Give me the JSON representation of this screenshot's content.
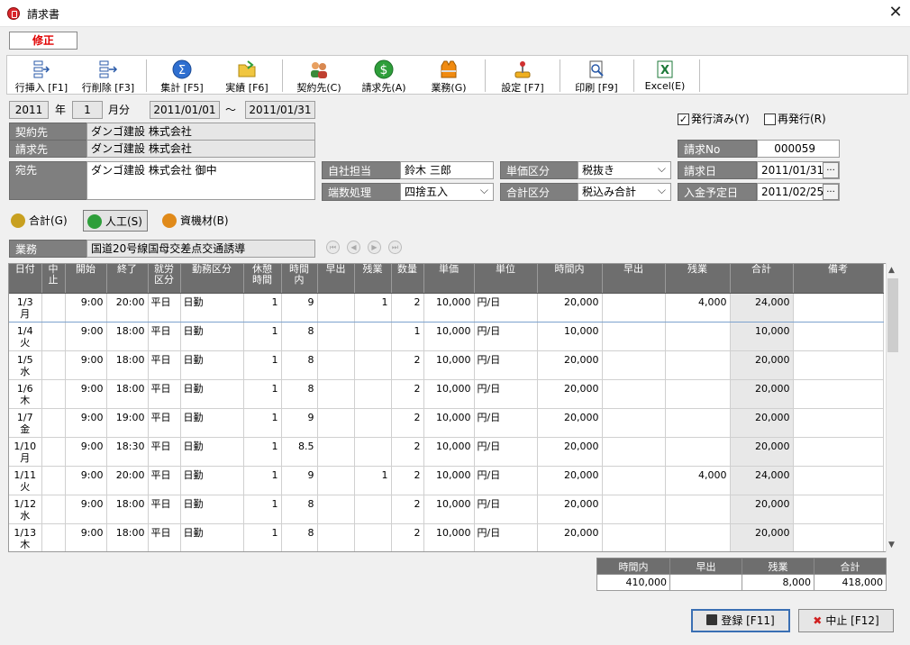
{
  "window": {
    "title": "請求書",
    "mode": "修正"
  },
  "toolbar": [
    {
      "label": "行挿入 [F1]",
      "icon": "insert-row-icon"
    },
    {
      "label": "行削除 [F3]",
      "icon": "delete-row-icon"
    },
    {
      "label": "集計 [F5]",
      "icon": "sigma-icon"
    },
    {
      "label": "実績 [F6]",
      "icon": "folder-icon"
    },
    {
      "label": "契約先(C)",
      "icon": "people-icon"
    },
    {
      "label": "請求先(A)",
      "icon": "dollar-icon"
    },
    {
      "label": "業務(G)",
      "icon": "vest-icon"
    },
    {
      "label": "設定 [F7]",
      "icon": "joystick-icon"
    },
    {
      "label": "印刷 [F9]",
      "icon": "print-preview-icon"
    },
    {
      "label": "Excel(E)",
      "icon": "excel-icon"
    }
  ],
  "period": {
    "year": "2011",
    "year_label": "年",
    "month": "1",
    "month_label": "月分",
    "from": "2011/01/01",
    "tilde": "～",
    "to": "2011/01/31"
  },
  "flags": {
    "issued_label": "発行済み(Y)",
    "issued": "✓",
    "reissue_label": "再発行(R)"
  },
  "contract": {
    "label": "契約先",
    "value": "ダンゴ建設 株式会社"
  },
  "billto": {
    "label": "請求先",
    "value": "ダンゴ建設 株式会社"
  },
  "address": {
    "label": "宛先",
    "value": "ダンゴ建設 株式会社 御中"
  },
  "staff": {
    "label": "自社担当",
    "value": "鈴木 三郎"
  },
  "rounding": {
    "label": "端数処理",
    "value": "四捨五入"
  },
  "price_type": {
    "label": "単価区分",
    "value": "税抜き"
  },
  "total_type": {
    "label": "合計区分",
    "value": "税込み合計"
  },
  "invoice_no": {
    "label": "請求No",
    "value": "000059"
  },
  "invoice_date": {
    "label": "請求日",
    "value": "2011/01/31",
    "btn": "..."
  },
  "payment_date": {
    "label": "入金予定日",
    "value": "2011/02/25",
    "btn": "..."
  },
  "tabs": [
    {
      "label": "合計(G)",
      "color": "#c8a020"
    },
    {
      "label": "人工(S)",
      "color": "#2e9e3a"
    },
    {
      "label": "資機材(B)",
      "color": "#e08a1a"
    }
  ],
  "gyomu": {
    "label": "業務",
    "value": "国道20号線国母交差点交通誘導"
  },
  "grid": {
    "headers": [
      "日付",
      "中止",
      "開始",
      "終了",
      "就労区分",
      "勤務区分",
      "休憩時間",
      "時間内",
      "早出",
      "残業",
      "数量",
      "単価",
      "単位",
      "時間内",
      "早出",
      "残業",
      "合計",
      "備考"
    ],
    "rows": [
      {
        "d": "1/3",
        "w": "月",
        "stop": "",
        "start": "9:00",
        "end": "20:00",
        "kubun": "平日",
        "kinmu": "日勤",
        "rest": "1",
        "jikan": "9",
        "hayade": "",
        "zangyo": "1",
        "qty": "2",
        "tanka": "10,000",
        "unit": "円/日",
        "a_jikan": "20,000",
        "a_hayade": "",
        "a_zangyo": "4,000",
        "total": "24,000",
        "note": ""
      },
      {
        "d": "1/4",
        "w": "火",
        "stop": "",
        "start": "9:00",
        "end": "18:00",
        "kubun": "平日",
        "kinmu": "日勤",
        "rest": "1",
        "jikan": "8",
        "hayade": "",
        "zangyo": "",
        "qty": "1",
        "tanka": "10,000",
        "unit": "円/日",
        "a_jikan": "10,000",
        "a_hayade": "",
        "a_zangyo": "",
        "total": "10,000",
        "note": ""
      },
      {
        "d": "1/5",
        "w": "水",
        "stop": "",
        "start": "9:00",
        "end": "18:00",
        "kubun": "平日",
        "kinmu": "日勤",
        "rest": "1",
        "jikan": "8",
        "hayade": "",
        "zangyo": "",
        "qty": "2",
        "tanka": "10,000",
        "unit": "円/日",
        "a_jikan": "20,000",
        "a_hayade": "",
        "a_zangyo": "",
        "total": "20,000",
        "note": ""
      },
      {
        "d": "1/6",
        "w": "木",
        "stop": "",
        "start": "9:00",
        "end": "18:00",
        "kubun": "平日",
        "kinmu": "日勤",
        "rest": "1",
        "jikan": "8",
        "hayade": "",
        "zangyo": "",
        "qty": "2",
        "tanka": "10,000",
        "unit": "円/日",
        "a_jikan": "20,000",
        "a_hayade": "",
        "a_zangyo": "",
        "total": "20,000",
        "note": ""
      },
      {
        "d": "1/7",
        "w": "金",
        "stop": "",
        "start": "9:00",
        "end": "19:00",
        "kubun": "平日",
        "kinmu": "日勤",
        "rest": "1",
        "jikan": "9",
        "hayade": "",
        "zangyo": "",
        "qty": "2",
        "tanka": "10,000",
        "unit": "円/日",
        "a_jikan": "20,000",
        "a_hayade": "",
        "a_zangyo": "",
        "total": "20,000",
        "note": ""
      },
      {
        "d": "1/10",
        "w": "月",
        "stop": "",
        "start": "9:00",
        "end": "18:30",
        "kubun": "平日",
        "kinmu": "日勤",
        "rest": "1",
        "jikan": "8.5",
        "hayade": "",
        "zangyo": "",
        "qty": "2",
        "tanka": "10,000",
        "unit": "円/日",
        "a_jikan": "20,000",
        "a_hayade": "",
        "a_zangyo": "",
        "total": "20,000",
        "note": ""
      },
      {
        "d": "1/11",
        "w": "火",
        "stop": "",
        "start": "9:00",
        "end": "20:00",
        "kubun": "平日",
        "kinmu": "日勤",
        "rest": "1",
        "jikan": "9",
        "hayade": "",
        "zangyo": "1",
        "qty": "2",
        "tanka": "10,000",
        "unit": "円/日",
        "a_jikan": "20,000",
        "a_hayade": "",
        "a_zangyo": "4,000",
        "total": "24,000",
        "note": ""
      },
      {
        "d": "1/12",
        "w": "水",
        "stop": "",
        "start": "9:00",
        "end": "18:00",
        "kubun": "平日",
        "kinmu": "日勤",
        "rest": "1",
        "jikan": "8",
        "hayade": "",
        "zangyo": "",
        "qty": "2",
        "tanka": "10,000",
        "unit": "円/日",
        "a_jikan": "20,000",
        "a_hayade": "",
        "a_zangyo": "",
        "total": "20,000",
        "note": ""
      },
      {
        "d": "1/13",
        "w": "木",
        "stop": "",
        "start": "9:00",
        "end": "18:00",
        "kubun": "平日",
        "kinmu": "日勤",
        "rest": "1",
        "jikan": "8",
        "hayade": "",
        "zangyo": "",
        "qty": "2",
        "tanka": "10,000",
        "unit": "円/日",
        "a_jikan": "20,000",
        "a_hayade": "",
        "a_zangyo": "",
        "total": "20,000",
        "note": ""
      }
    ]
  },
  "totals": {
    "headers": [
      "時間内",
      "早出",
      "残業",
      "合計"
    ],
    "values": [
      "410,000",
      "",
      "8,000",
      "418,000"
    ]
  },
  "actions": {
    "save": "登録 [F11]",
    "cancel": "中止 [F12]"
  }
}
